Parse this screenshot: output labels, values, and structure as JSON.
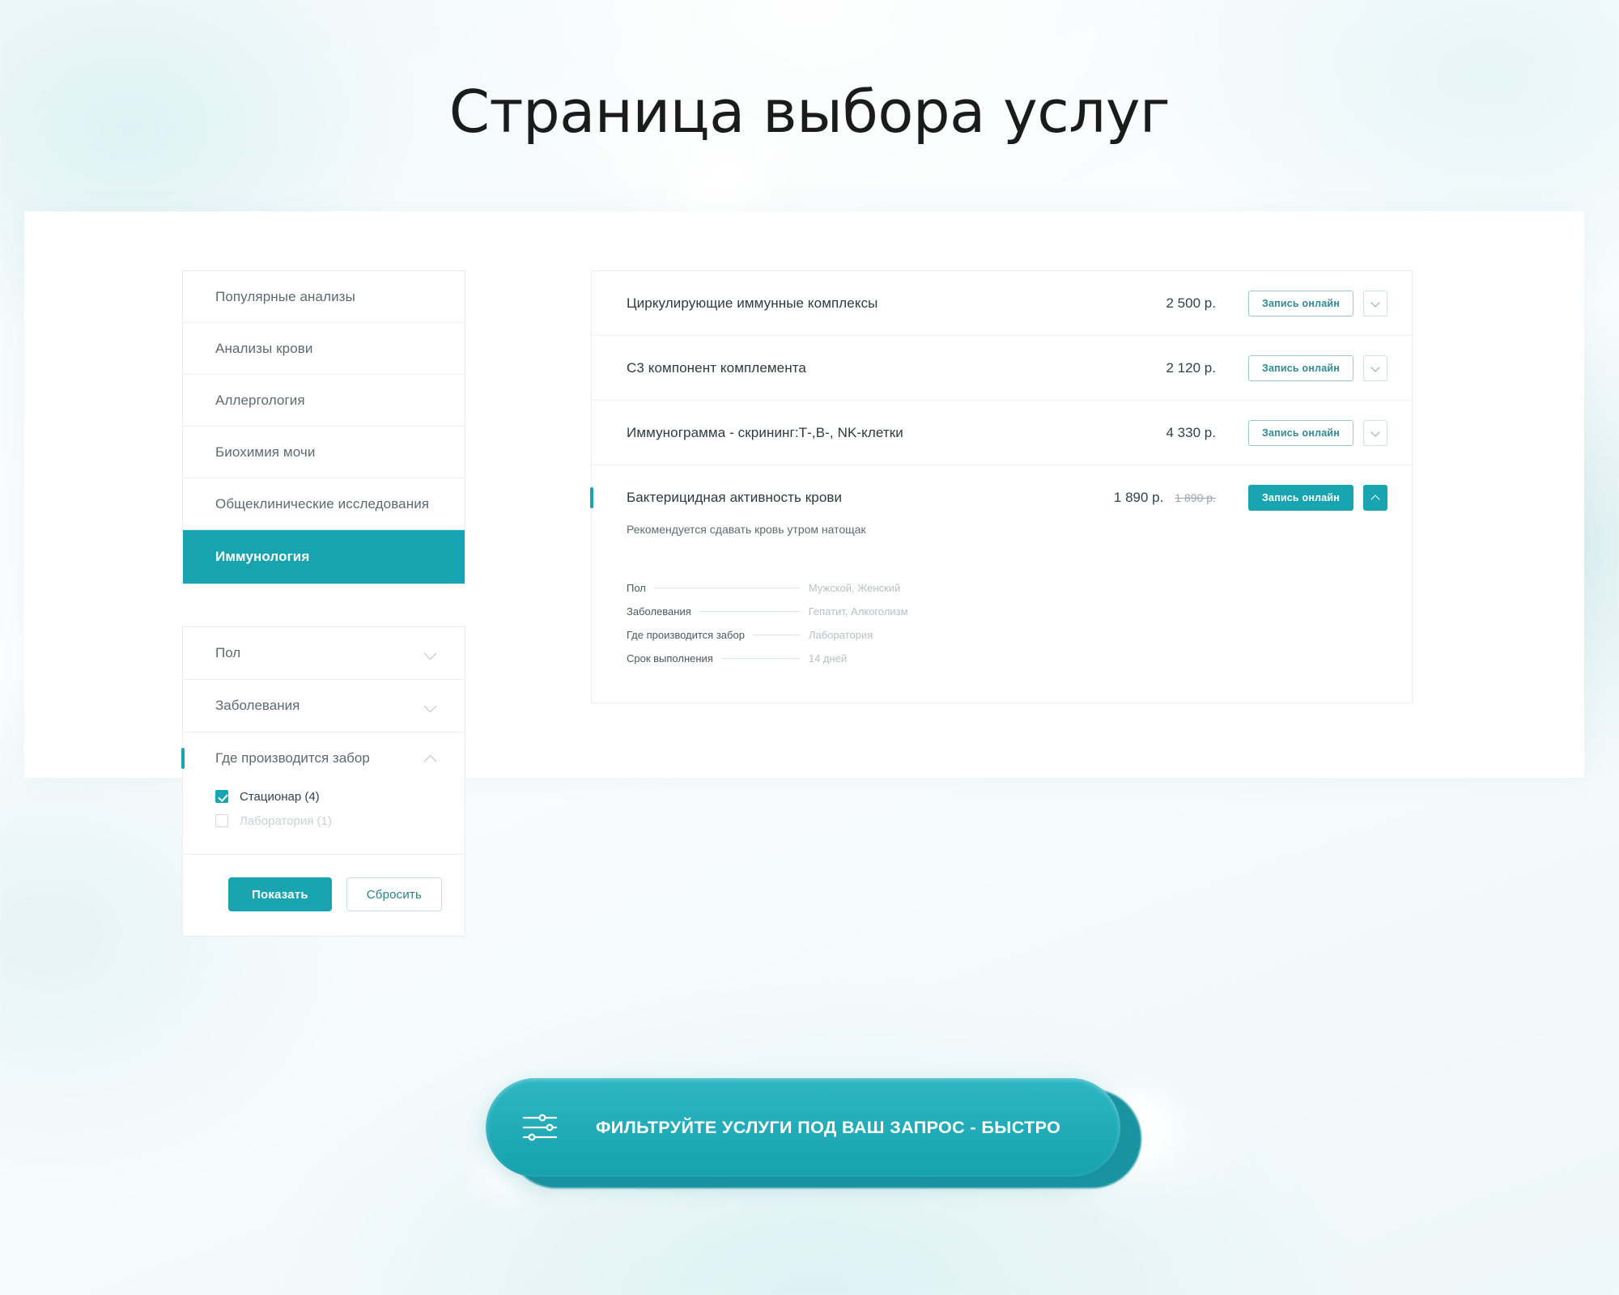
{
  "page": {
    "title": "Страница выбора услуг"
  },
  "theme": {
    "accent": "#19a4b1",
    "accent_dark": "#0f8f9d",
    "text": "#2e3a40",
    "muted": "#9aa6ab"
  },
  "sidebar": {
    "categories": [
      {
        "label": "Популярные анализы",
        "active": false
      },
      {
        "label": "Анализы крови",
        "active": false
      },
      {
        "label": "Аллергология",
        "active": false
      },
      {
        "label": "Биохимия мочи",
        "active": false
      },
      {
        "label": "Общеклинические исследования",
        "active": false
      },
      {
        "label": "Иммунология",
        "active": true
      }
    ]
  },
  "filters": {
    "groups": [
      {
        "label": "Пол",
        "expanded": false,
        "options": []
      },
      {
        "label": "Заболевания",
        "expanded": false,
        "options": []
      },
      {
        "label": "Где производится забор",
        "expanded": true,
        "options": [
          {
            "label": "Стационар (4)",
            "checked": true,
            "disabled": false
          },
          {
            "label": "Лаборатория (1)",
            "checked": false,
            "disabled": true
          }
        ]
      }
    ],
    "apply_label": "Показать",
    "reset_label": "Сбросить"
  },
  "services": {
    "book_label": "Запись онлайн",
    "items": [
      {
        "name": "Циркулирующие иммунные комплексы",
        "price": "2 500 р.",
        "price_old": "",
        "expanded": false
      },
      {
        "name": "C3 компонент комплемента",
        "price": "2 120 р.",
        "price_old": "",
        "expanded": false
      },
      {
        "name": "Иммунограмма - скрининг:Т-,В-, NK-клетки",
        "price": "4 330 р.",
        "price_old": "",
        "expanded": false
      },
      {
        "name": "Бактерицидная активность крови",
        "price": "1 890 р.",
        "price_old": "1 890 р.",
        "expanded": true,
        "note": "Рекомендуется сдавать кровь утром натощак",
        "details": [
          {
            "label": "Пол",
            "value": "Мужской, Женский"
          },
          {
            "label": "Заболевания",
            "value": "Гепатит, Алкоголизм"
          },
          {
            "label": "Где производится забор",
            "value": "Лаборатория"
          },
          {
            "label": "Срок выполнения",
            "value": "14 дней"
          }
        ]
      }
    ]
  },
  "banner": {
    "text": "ФИЛЬТРУЙТЕ УСЛУГИ ПОД ВАШ ЗАПРОС - БЫСТРО",
    "icon": "sliders-icon"
  }
}
